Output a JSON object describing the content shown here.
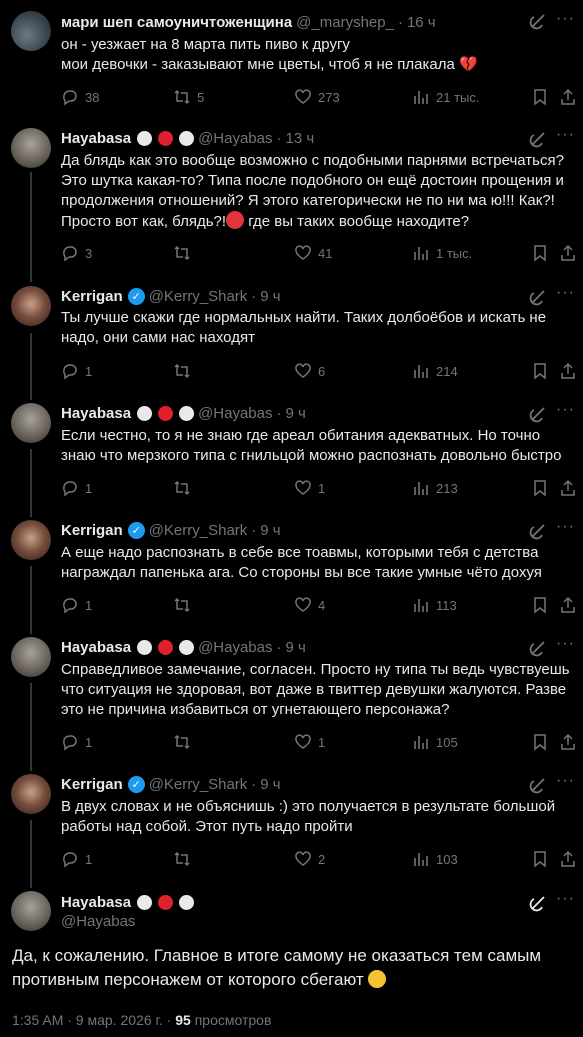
{
  "tweets": [
    {
      "name": "мари шеп самоуничтоженщина",
      "handle": "@_maryshep_",
      "time": "16 ч",
      "text": "он - уезжает на 8 марта пить пиво к другу\nмои девочки - заказывают мне цветы, чтоб я не плакала",
      "emoji": "💔",
      "replies": "38",
      "retweets": "5",
      "likes": "273",
      "views": "21 тыс."
    },
    {
      "name": "Hayabasa",
      "handle": "@Hayabas",
      "time": "13 ч",
      "text": "Да блядь как это вообще возможно с подобными парнями встречаться? Это шутка какая-то? Типа после подобного он ещё достоин прощения и продолжения отношений? Я этого категорически не по ни ма ю!!! Как?! Просто вот как, блядь?!",
      "text_tail": " где вы таких вообще находите?",
      "replies": "3",
      "retweets": "",
      "likes": "41",
      "views": "1 тыс."
    },
    {
      "name": "Kerrigan",
      "handle": "@Kerry_Shark",
      "time": "9 ч",
      "text": "Ты лучше скажи где нормальных найти. Таких долбоёбов и искать не надо, они сами нас находят",
      "replies": "1",
      "retweets": "",
      "likes": "6",
      "views": "214"
    },
    {
      "name": "Hayabasa",
      "handle": "@Hayabas",
      "time": "9 ч",
      "text": "Если честно, то я не знаю где ареал обитания адекватных. Но точно знаю что мерзкого типа с гнильцой можно распознать довольно быстро",
      "replies": "1",
      "retweets": "",
      "likes": "1",
      "views": "213"
    },
    {
      "name": "Kerrigan",
      "handle": "@Kerry_Shark",
      "time": "9 ч",
      "text": "А еще надо распознать в себе все тоавмы, которыми тебя с детства награждал папенька ага. Со стороны вы все такие умные чёто дохуя",
      "replies": "1",
      "retweets": "",
      "likes": "4",
      "views": "113"
    },
    {
      "name": "Hayabasa",
      "handle": "@Hayabas",
      "time": "9 ч",
      "text": "Справедливое замечание, согласен. Просто ну типа ты ведь чувствуешь что ситуация не здоровая, вот даже в твиттер девушки жалуются. Разве это не причина избавиться от угнетающего персонажа?",
      "replies": "1",
      "retweets": "",
      "likes": "1",
      "views": "105"
    },
    {
      "name": "Kerrigan",
      "handle": "@Kerry_Shark",
      "time": "9 ч",
      "text": "В двух словах и не объяснишь :) это получается в результате большой работы над собой. Этот путь надо пройти",
      "replies": "1",
      "retweets": "",
      "likes": "2",
      "views": "103"
    }
  ],
  "final": {
    "name": "Hayabasa",
    "handle": "@Hayabas",
    "text": "Да, к сожалению. Главное в итоге самому не оказаться тем самым противным персонажем от которого сбегают",
    "time": "1:35 AM · 9 мар. 2026 г. ·",
    "views_count": "95",
    "views_label": "просмотров"
  },
  "ui": {
    "dot": "·",
    "more": "···",
    "check": "✓"
  }
}
